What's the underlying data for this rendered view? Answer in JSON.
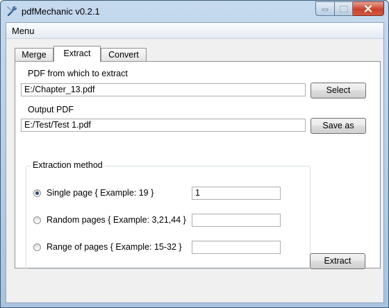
{
  "window": {
    "title": "pdfMechanic v0.2.1"
  },
  "menu": {
    "items": [
      "Menu"
    ]
  },
  "tabs": [
    {
      "label": "Merge",
      "active": false
    },
    {
      "label": "Extract",
      "active": true
    },
    {
      "label": "Convert",
      "active": false
    }
  ],
  "extract": {
    "source_label": "PDF from which to extract",
    "source_value": "E:/Chapter_13.pdf",
    "select_button": "Select",
    "output_label": "Output PDF",
    "output_value": "E:/Test/Test 1.pdf",
    "save_as_button": "Save as",
    "method_title": "Extraction method",
    "methods": [
      {
        "label": "Single page { Example: 19 }",
        "value": "1",
        "selected": true
      },
      {
        "label": "Random pages { Example: 3,21,44 }",
        "value": "",
        "selected": false
      },
      {
        "label": "Range of pages { Example: 15-32 }",
        "value": "",
        "selected": false
      }
    ],
    "extract_button": "Extract"
  },
  "icons": {
    "app": "wrench-icon",
    "minimize": "minimize-icon",
    "maximize": "maximize-icon",
    "close": "close-icon"
  }
}
